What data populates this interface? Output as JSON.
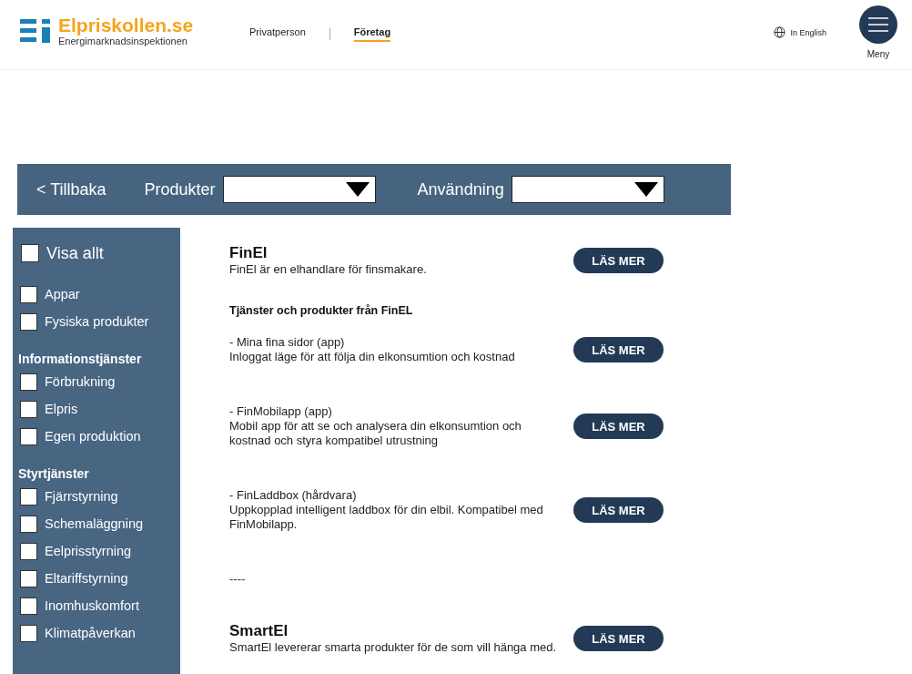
{
  "header": {
    "logo_title": "Elpriskollen.se",
    "logo_subtitle": "Energimarknadsinspektionen",
    "nav": [
      {
        "label": "Privatperson",
        "selected": false
      },
      {
        "label": "Företag",
        "selected": true
      }
    ],
    "language_link": "In English",
    "menu_label": "Meny"
  },
  "filter_bar": {
    "back_link": "< Tillbaka",
    "filters": [
      {
        "label": "Produkter"
      },
      {
        "label": "Användning"
      }
    ]
  },
  "sidebar": {
    "show_all": {
      "label": "Visa allt",
      "checked": false
    },
    "groups": [
      {
        "items": [
          {
            "label": "Appar",
            "checked": false
          },
          {
            "label": "Fysiska produkter",
            "checked": false
          }
        ]
      },
      {
        "heading": "Informationstjänster",
        "items": [
          {
            "label": "Förbrukning",
            "checked": false
          },
          {
            "label": "Elpris",
            "checked": false
          },
          {
            "label": "Egen produktion",
            "checked": false
          }
        ]
      },
      {
        "heading": "Styrtjänster",
        "items": [
          {
            "label": "Fjärrstyrning",
            "checked": false
          },
          {
            "label": "Schemaläggning",
            "checked": false
          },
          {
            "label": "Eelprisstyrning",
            "checked": false
          },
          {
            "label": "Eltariffstyrning",
            "checked": false
          },
          {
            "label": "Inomhuskomfort",
            "checked": false
          },
          {
            "label": "Klimatpåverkan",
            "checked": false
          }
        ]
      }
    ]
  },
  "content": [
    {
      "kind": "provider",
      "title": "FinEl",
      "text": "FinEl är en elhandlare för finsmakare.",
      "button": "LÄS MER"
    },
    {
      "kind": "heading",
      "text": "Tjänster och produkter från FinEL"
    },
    {
      "kind": "product",
      "title": "- Mina fina sidor (app)",
      "text": "Inloggat läge för att följa din elkonsumtion och kostnad",
      "button": "LÄS MER"
    },
    {
      "kind": "product",
      "title": "- FinMobilapp (app)",
      "text": "Mobil app för att se och analysera din elkonsumtion och kostnad och styra kompatibel utrustning",
      "button": "LÄS MER"
    },
    {
      "kind": "product",
      "title": "- FinLaddbox (hårdvara)",
      "text": "Uppkopplad intelligent laddbox för din elbil. Kompatibel med FinMobilapp.",
      "button": "LÄS MER"
    },
    {
      "kind": "divider",
      "text": "----"
    },
    {
      "kind": "provider",
      "title": "SmartEl",
      "text": "SmartEl levererar smarta produkter för de som vill hänga med.",
      "button": "LÄS MER"
    }
  ]
}
